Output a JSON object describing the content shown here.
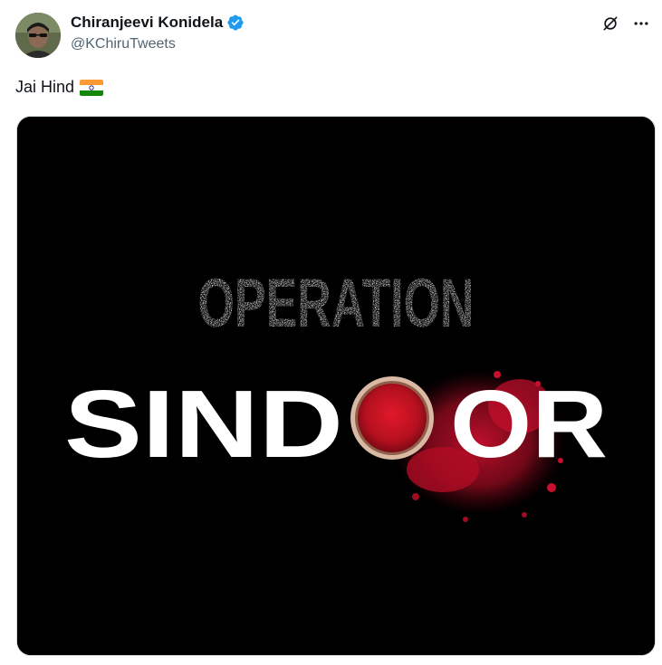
{
  "author": {
    "display_name": "Chiranjeevi Konidela",
    "handle": "@KChiruTweets",
    "verified": true
  },
  "tweet": {
    "text": "Jai Hind",
    "emoji": "india-flag"
  },
  "media": {
    "line1": "OPERATION",
    "line2_part1": "SIND",
    "line2_part2": "OR"
  },
  "icons": {
    "grok": "grok-icon",
    "more": "more-options-icon",
    "verified": "verified-badge-icon"
  },
  "colors": {
    "verified_blue": "#1d9bf0",
    "handle_gray": "#536471",
    "sindoor_red": "#c8102e"
  }
}
